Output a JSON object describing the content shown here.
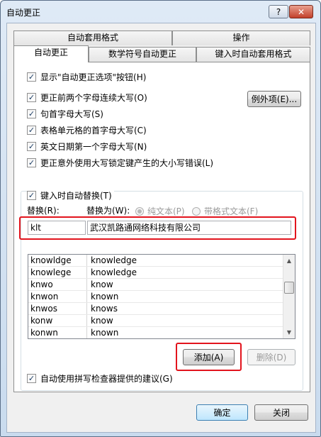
{
  "window": {
    "title": "自动更正",
    "help_glyph": "?",
    "close_glyph": "✕"
  },
  "tabs": {
    "back_row": [
      "自动套用格式",
      "操作"
    ],
    "front_row": [
      "自动更正",
      "数学符号自动更正",
      "键入时自动套用格式"
    ],
    "active": "自动更正"
  },
  "options": {
    "show_button": {
      "label": "显示\"自动更正选项\"按钮(H)",
      "checked": true
    },
    "two_initial": {
      "label": "更正前两个字母连续大写(O)",
      "checked": true
    },
    "sentence_cap": {
      "label": "句首字母大写(S)",
      "checked": true
    },
    "table_cap": {
      "label": "表格单元格的首字母大写(C)",
      "checked": true
    },
    "days_cap": {
      "label": "英文日期第一个字母大写(N)",
      "checked": true
    },
    "caps_lock": {
      "label": "更正意外使用大写锁定键产生的大小写错误(L)",
      "checked": true
    },
    "exceptions_button": "例外项(E)..."
  },
  "replace_section": {
    "replace_as_type": {
      "label": "键入时自动替换(T)",
      "checked": true
    },
    "replace_label": "替换(R):",
    "with_label": "替换为(W):",
    "plain_text": {
      "label": "纯文本(P)",
      "selected": true,
      "enabled": false
    },
    "formatted_text": {
      "label": "带格式文本(F)",
      "selected": false,
      "enabled": false
    },
    "replace_value": "klt",
    "with_value": "武汉凯路通网络科技有限公司"
  },
  "entries": [
    [
      "knowldge",
      "knowledge"
    ],
    [
      "knowlege",
      "knowledge"
    ],
    [
      "knwo",
      "know"
    ],
    [
      "knwon",
      "known"
    ],
    [
      "knwos",
      "knows"
    ],
    [
      "konw",
      "know"
    ],
    [
      "konwn",
      "known"
    ]
  ],
  "buttons": {
    "add": "添加(A)",
    "delete": "删除(D)",
    "ok": "确定",
    "close": "关闭"
  },
  "spelling_suggest": {
    "label": "自动使用拼写检查器提供的建议(G)",
    "checked": true
  },
  "colors": {
    "highlight_red": "#e2141d"
  },
  "check_glyph": "✓",
  "scroll_up_glyph": "▲",
  "scroll_down_glyph": "▼"
}
